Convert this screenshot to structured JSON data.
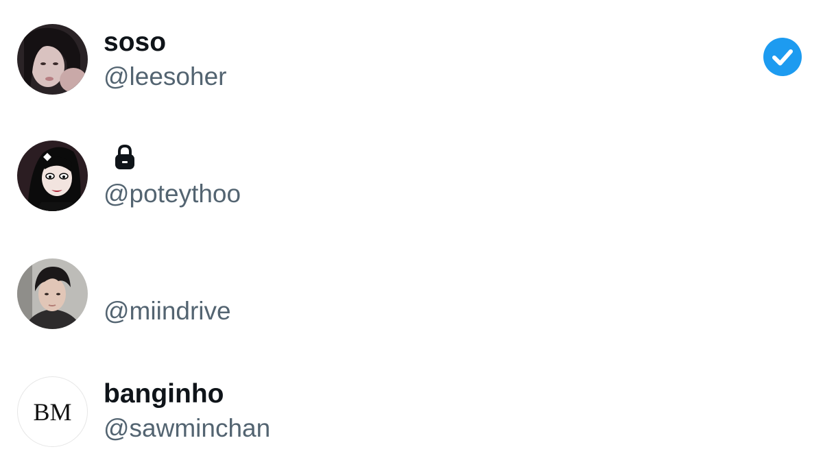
{
  "accounts": [
    {
      "display_name": "soso",
      "handle": "@leesoher",
      "avatar_icon": "photo-avatar",
      "selected": true,
      "check_icon": "checkmark-icon",
      "check_color": "#1d9bf0"
    },
    {
      "display_name": "",
      "handle": "@poteythoo",
      "avatar_icon": "cartoon-avatar",
      "protected_icon": "lock-icon"
    },
    {
      "display_name": "",
      "handle": "@miindrive",
      "avatar_icon": "photo-avatar"
    },
    {
      "display_name": "banginho",
      "handle": "@sawminchan",
      "avatar_text": "BM"
    }
  ],
  "colors": {
    "name": "#0f1419",
    "handle": "#536471",
    "accent": "#1d9bf0"
  }
}
